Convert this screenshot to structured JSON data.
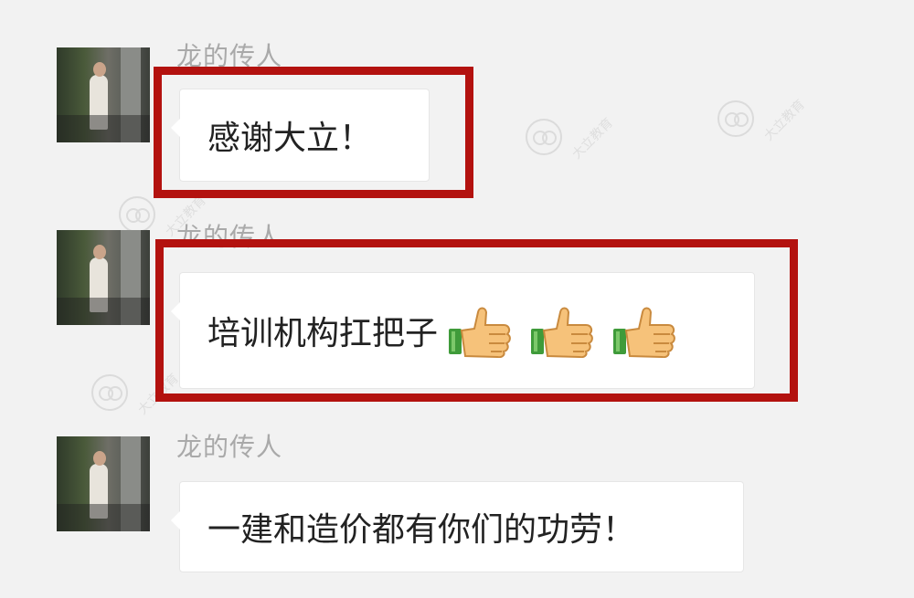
{
  "chat": {
    "messages": [
      {
        "sender": "龙的传人",
        "text": "感谢大立！",
        "highlighted": true
      },
      {
        "sender": "龙的传人",
        "text": "培训机构扛把子",
        "emoji": [
          "thumbs-up",
          "thumbs-up",
          "thumbs-up"
        ],
        "highlighted": true
      },
      {
        "sender": "龙的传人",
        "text": "一建和造价都有你们的功劳！",
        "highlighted": false
      }
    ]
  },
  "watermark": {
    "text": "大立教育"
  },
  "colors": {
    "highlight": "#b3120f",
    "sender": "#a9a9a9",
    "background": "#f2f2f2"
  }
}
